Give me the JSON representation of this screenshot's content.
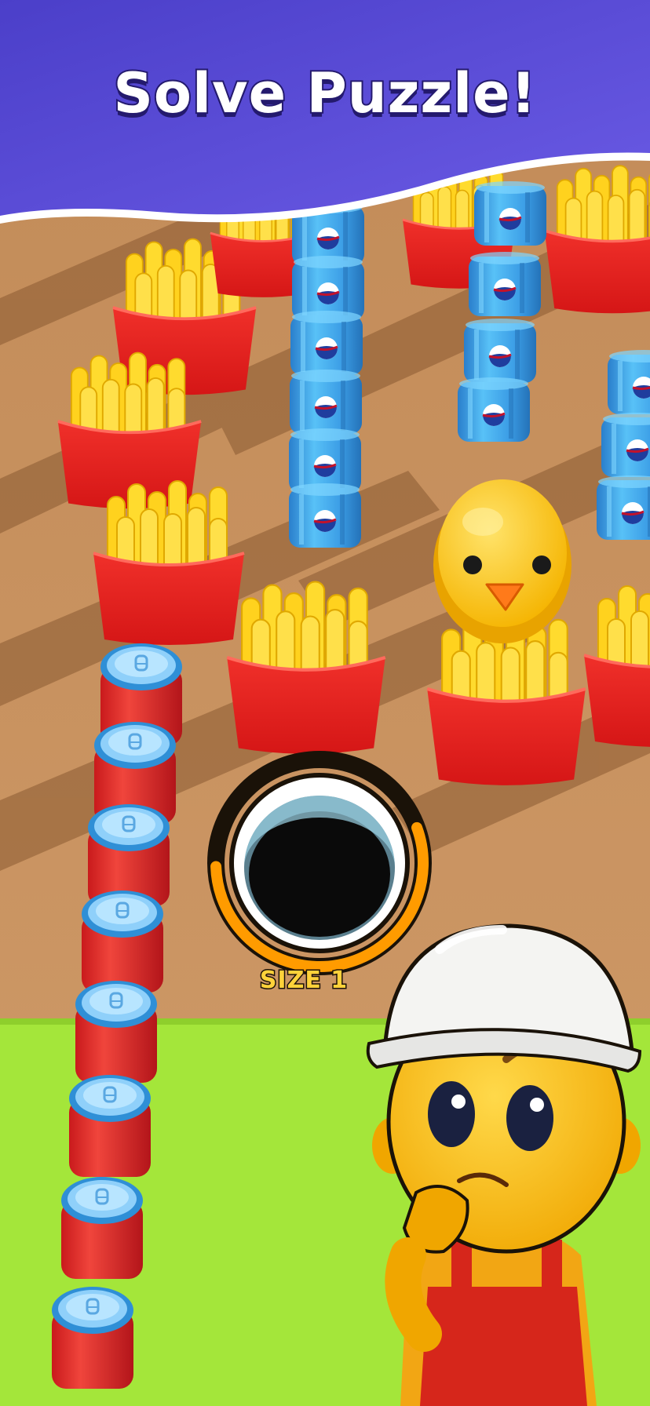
{
  "banner": {
    "title": "Solve Puzzle!"
  },
  "hole": {
    "size_label": "SIZE 1",
    "progress": 0.55
  },
  "colors": {
    "banner": "#5a4bd6",
    "ground": "#c58f5c",
    "grass": "#a4e63a",
    "fries": "#ffd21e",
    "fry_box": "#e81d1d",
    "blue_can": "#3fa3ec",
    "red_can": "#e8302d",
    "duck": "#ffcc1a",
    "ring": "#ff9b00"
  },
  "icons": [
    "fries-box-icon",
    "blue-soda-can-icon",
    "red-soda-can-icon",
    "rubber-duck-icon",
    "black-hole-icon",
    "worker-character-icon"
  ]
}
